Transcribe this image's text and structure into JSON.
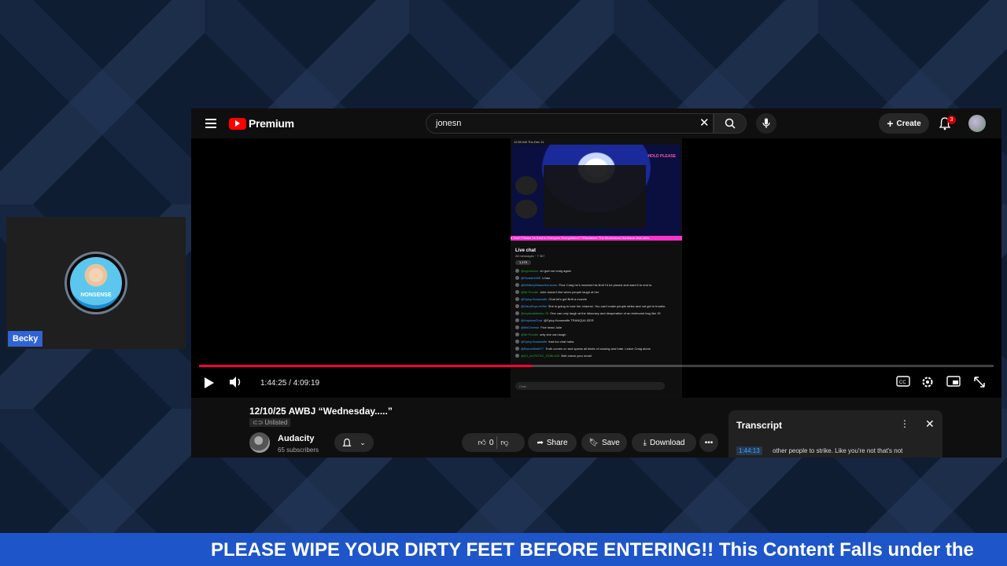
{
  "stream": {
    "cam_label": "Becky",
    "avatar_text": "NONSENSE",
    "ticker": "PLEASE WIPE YOUR DIRTY FEET BEFORE ENTERING!! This Content Falls under the"
  },
  "youtube": {
    "logo": "Premium",
    "search_value": "jonesn",
    "create_label": "Create",
    "notification_count": "3",
    "video": {
      "status_bar": "12:50 AM   Thu Dec 11",
      "hold_text": "HOLD PLEASE",
      "overlay_ticker": "d Visit? Please be Kind to Everyone Everywhere!! **Disclaimer The Moderators Nonissue chat rules",
      "chat_title": "Live chat",
      "chat_sub": "All messages  ·  7 367",
      "chat_count": "1,170",
      "chat_messages": [
        {
          "user": "@ughchoice",
          "text": "oh god not craig again"
        },
        {
          "user": "@Swade1605",
          "text": "Lmao"
        },
        {
          "user": "@WhitneyMasonKonsulor",
          "text": "Poor Craig he's reached his limit I'd be pissed and want it to end to"
        },
        {
          "user": "@Mr.Poodle",
          "text": "Julie doesn't like when people laugh at her"
        },
        {
          "user": "@Spicy.Housewife",
          "text": "Chat let's get Britt a muzzle"
        },
        {
          "user": "@GaryKeys-hn5bl",
          "text": "She is going to lose her channel. You can't make people strike and not get in trouble."
        },
        {
          "user": "@mysteakfeelsv-76",
          "text": "One can only laugh at the idiocracy and desperation of an irrelevant hag like JS"
        },
        {
          "user": "@HoplessChat",
          "text": "@Spicy.Housewife TRANQUILIZER"
        },
        {
          "user": "@MsCheese",
          "text": "Five head Julie"
        },
        {
          "user": "@Mr.Poodle",
          "text": "only she can laugh"
        },
        {
          "user": "@Spicy.Housewife",
          "text": "that too chat haha"
        },
        {
          "user": "@BrunerBrett77",
          "text": "Truth comes on and spews all kinds of cussing and hate. Leave Craig alone"
        },
        {
          "user": "@DJ_AUTISTIC_GOBLINS",
          "text": "Britt check your email"
        }
      ],
      "chat_placeholder": "Chat...",
      "time_display": "1:44:25 / 4:09:19",
      "progress": 0.42
    },
    "title": "12/10/25 AWBJ “Wednesday.....”",
    "visibility": "Unlisted",
    "channel": "Audacity",
    "subscribers": "65 subscribers",
    "likes": "0",
    "share_label": "Share",
    "save_label": "Save",
    "download_label": "Download",
    "transcript": {
      "title": "Transcript",
      "timestamp": "1:44:13",
      "text": "other people to strike. Like you're not that's not"
    }
  },
  "colors": {
    "accent_red": "#ff0033",
    "ticker_blue": "#1e56c9",
    "cam_label_blue": "#2f63d6"
  }
}
